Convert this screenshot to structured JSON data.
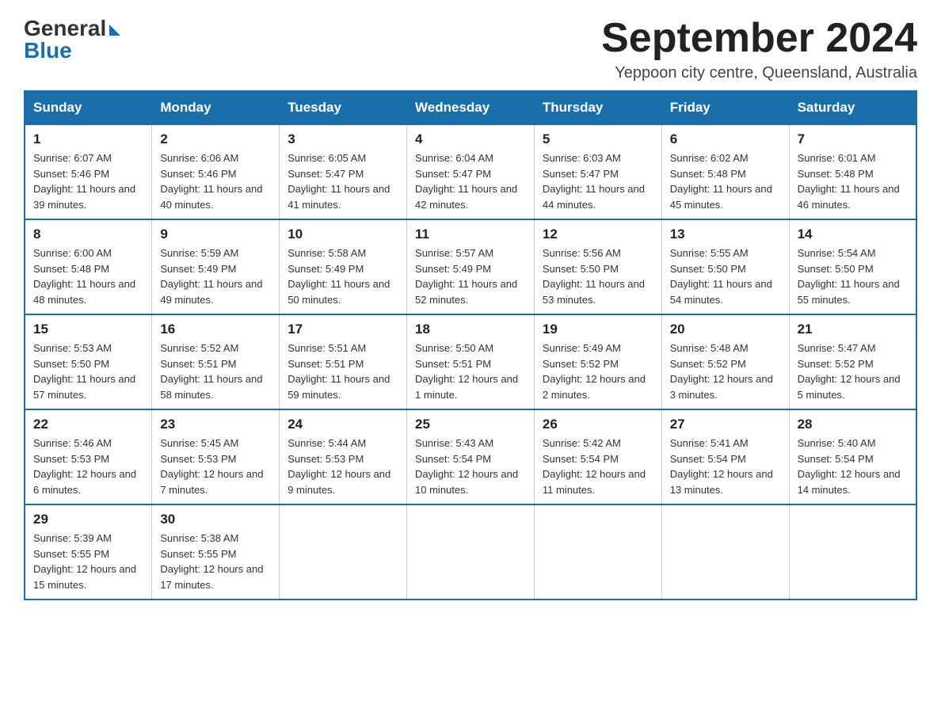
{
  "header": {
    "logo_general": "General",
    "logo_blue": "Blue",
    "month_title": "September 2024",
    "location": "Yeppoon city centre, Queensland, Australia"
  },
  "weekdays": [
    "Sunday",
    "Monday",
    "Tuesday",
    "Wednesday",
    "Thursday",
    "Friday",
    "Saturday"
  ],
  "weeks": [
    [
      {
        "day": "1",
        "sunrise": "6:07 AM",
        "sunset": "5:46 PM",
        "daylight": "11 hours and 39 minutes."
      },
      {
        "day": "2",
        "sunrise": "6:06 AM",
        "sunset": "5:46 PM",
        "daylight": "11 hours and 40 minutes."
      },
      {
        "day": "3",
        "sunrise": "6:05 AM",
        "sunset": "5:47 PM",
        "daylight": "11 hours and 41 minutes."
      },
      {
        "day": "4",
        "sunrise": "6:04 AM",
        "sunset": "5:47 PM",
        "daylight": "11 hours and 42 minutes."
      },
      {
        "day": "5",
        "sunrise": "6:03 AM",
        "sunset": "5:47 PM",
        "daylight": "11 hours and 44 minutes."
      },
      {
        "day": "6",
        "sunrise": "6:02 AM",
        "sunset": "5:48 PM",
        "daylight": "11 hours and 45 minutes."
      },
      {
        "day": "7",
        "sunrise": "6:01 AM",
        "sunset": "5:48 PM",
        "daylight": "11 hours and 46 minutes."
      }
    ],
    [
      {
        "day": "8",
        "sunrise": "6:00 AM",
        "sunset": "5:48 PM",
        "daylight": "11 hours and 48 minutes."
      },
      {
        "day": "9",
        "sunrise": "5:59 AM",
        "sunset": "5:49 PM",
        "daylight": "11 hours and 49 minutes."
      },
      {
        "day": "10",
        "sunrise": "5:58 AM",
        "sunset": "5:49 PM",
        "daylight": "11 hours and 50 minutes."
      },
      {
        "day": "11",
        "sunrise": "5:57 AM",
        "sunset": "5:49 PM",
        "daylight": "11 hours and 52 minutes."
      },
      {
        "day": "12",
        "sunrise": "5:56 AM",
        "sunset": "5:50 PM",
        "daylight": "11 hours and 53 minutes."
      },
      {
        "day": "13",
        "sunrise": "5:55 AM",
        "sunset": "5:50 PM",
        "daylight": "11 hours and 54 minutes."
      },
      {
        "day": "14",
        "sunrise": "5:54 AM",
        "sunset": "5:50 PM",
        "daylight": "11 hours and 55 minutes."
      }
    ],
    [
      {
        "day": "15",
        "sunrise": "5:53 AM",
        "sunset": "5:50 PM",
        "daylight": "11 hours and 57 minutes."
      },
      {
        "day": "16",
        "sunrise": "5:52 AM",
        "sunset": "5:51 PM",
        "daylight": "11 hours and 58 minutes."
      },
      {
        "day": "17",
        "sunrise": "5:51 AM",
        "sunset": "5:51 PM",
        "daylight": "11 hours and 59 minutes."
      },
      {
        "day": "18",
        "sunrise": "5:50 AM",
        "sunset": "5:51 PM",
        "daylight": "12 hours and 1 minute."
      },
      {
        "day": "19",
        "sunrise": "5:49 AM",
        "sunset": "5:52 PM",
        "daylight": "12 hours and 2 minutes."
      },
      {
        "day": "20",
        "sunrise": "5:48 AM",
        "sunset": "5:52 PM",
        "daylight": "12 hours and 3 minutes."
      },
      {
        "day": "21",
        "sunrise": "5:47 AM",
        "sunset": "5:52 PM",
        "daylight": "12 hours and 5 minutes."
      }
    ],
    [
      {
        "day": "22",
        "sunrise": "5:46 AM",
        "sunset": "5:53 PM",
        "daylight": "12 hours and 6 minutes."
      },
      {
        "day": "23",
        "sunrise": "5:45 AM",
        "sunset": "5:53 PM",
        "daylight": "12 hours and 7 minutes."
      },
      {
        "day": "24",
        "sunrise": "5:44 AM",
        "sunset": "5:53 PM",
        "daylight": "12 hours and 9 minutes."
      },
      {
        "day": "25",
        "sunrise": "5:43 AM",
        "sunset": "5:54 PM",
        "daylight": "12 hours and 10 minutes."
      },
      {
        "day": "26",
        "sunrise": "5:42 AM",
        "sunset": "5:54 PM",
        "daylight": "12 hours and 11 minutes."
      },
      {
        "day": "27",
        "sunrise": "5:41 AM",
        "sunset": "5:54 PM",
        "daylight": "12 hours and 13 minutes."
      },
      {
        "day": "28",
        "sunrise": "5:40 AM",
        "sunset": "5:54 PM",
        "daylight": "12 hours and 14 minutes."
      }
    ],
    [
      {
        "day": "29",
        "sunrise": "5:39 AM",
        "sunset": "5:55 PM",
        "daylight": "12 hours and 15 minutes."
      },
      {
        "day": "30",
        "sunrise": "5:38 AM",
        "sunset": "5:55 PM",
        "daylight": "12 hours and 17 minutes."
      },
      null,
      null,
      null,
      null,
      null
    ]
  ]
}
